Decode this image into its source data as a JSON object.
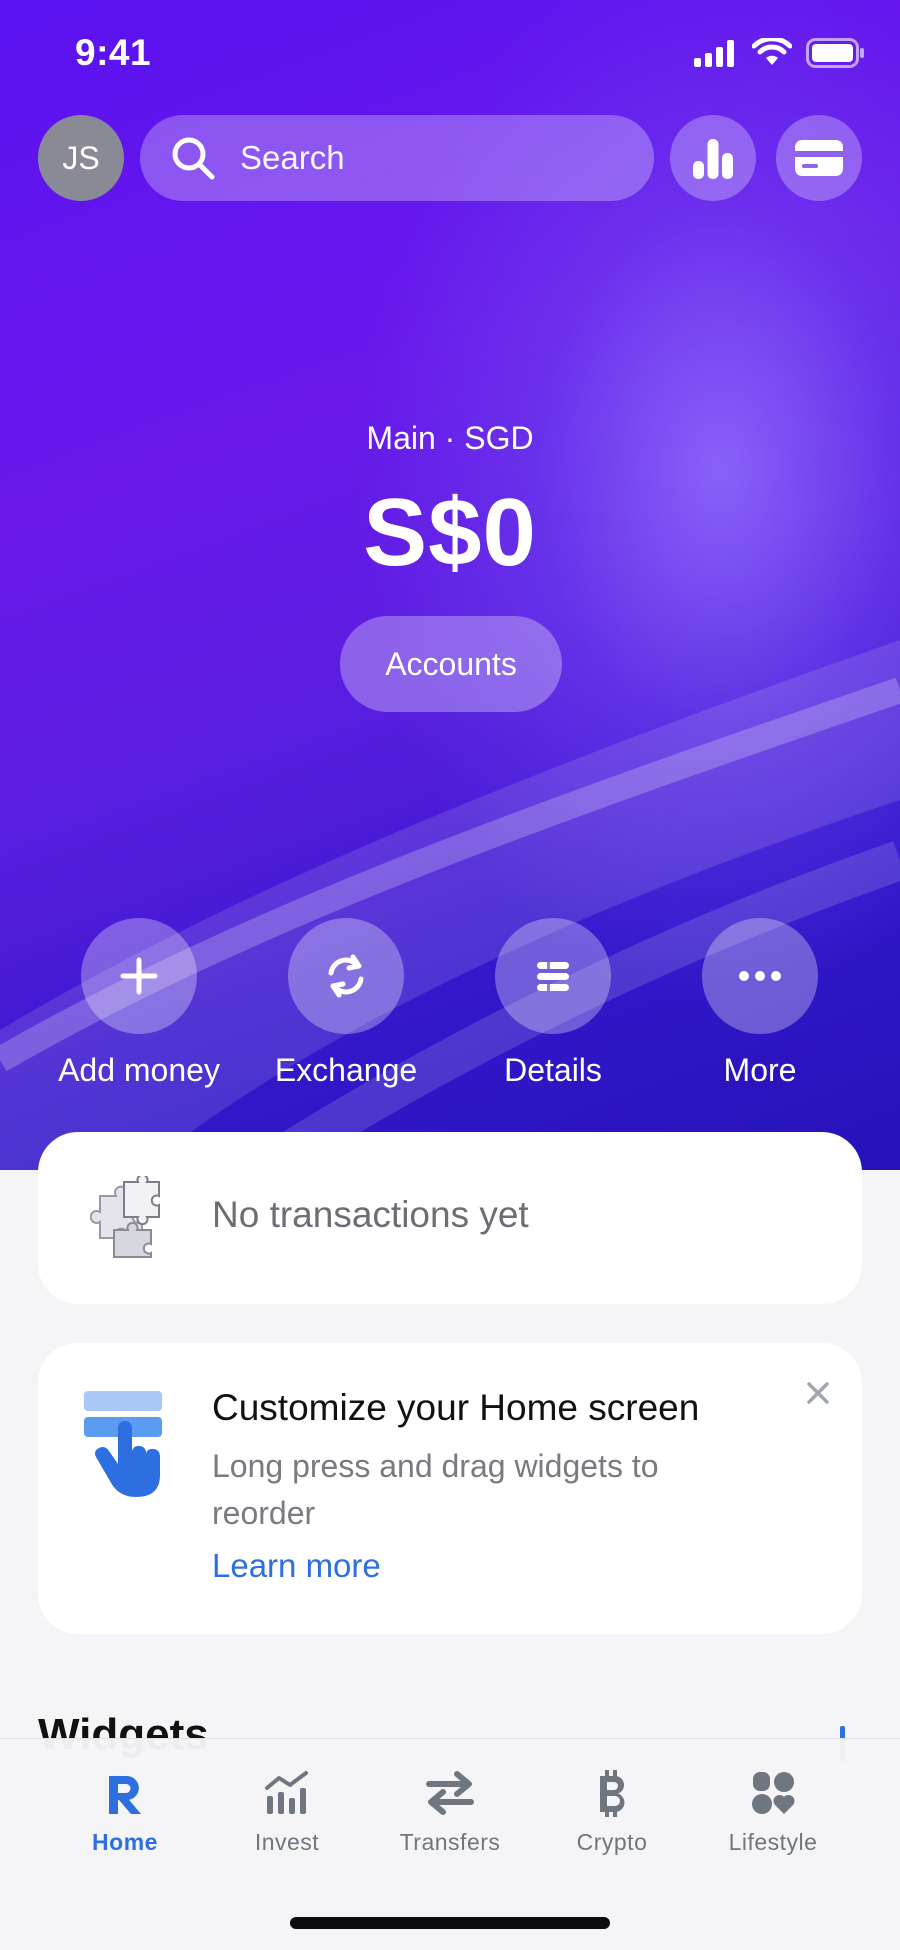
{
  "status_bar": {
    "time": "9:41"
  },
  "header": {
    "avatar_initials": "JS",
    "search_placeholder": "Search"
  },
  "balance": {
    "label": "Main · SGD",
    "amount": "S$0",
    "accounts_button": "Accounts"
  },
  "actions": [
    {
      "label": "Add money",
      "icon": "plus-icon"
    },
    {
      "label": "Exchange",
      "icon": "exchange-icon"
    },
    {
      "label": "Details",
      "icon": "details-icon"
    },
    {
      "label": "More",
      "icon": "more-icon"
    }
  ],
  "transactions_card": {
    "empty_text": "No transactions yet",
    "icon": "puzzle-icon"
  },
  "customize_card": {
    "title": "Customize your Home screen",
    "description": "Long press and drag widgets to reorder",
    "link": "Learn more"
  },
  "widgets": {
    "title": "Widgets"
  },
  "tabbar": [
    {
      "label": "Home",
      "icon": "revolut-logo-icon",
      "active": true
    },
    {
      "label": "Invest",
      "icon": "invest-chart-icon",
      "active": false
    },
    {
      "label": "Transfers",
      "icon": "transfers-arrows-icon",
      "active": false
    },
    {
      "label": "Crypto",
      "icon": "bitcoin-icon",
      "active": false
    },
    {
      "label": "Lifestyle",
      "icon": "lifestyle-icon",
      "active": false
    }
  ],
  "colors": {
    "hero_primary": "#5a12f0",
    "hero_secondary": "#2512b8",
    "accent_blue": "#2d6fe0",
    "background": "#f5f5f7"
  }
}
